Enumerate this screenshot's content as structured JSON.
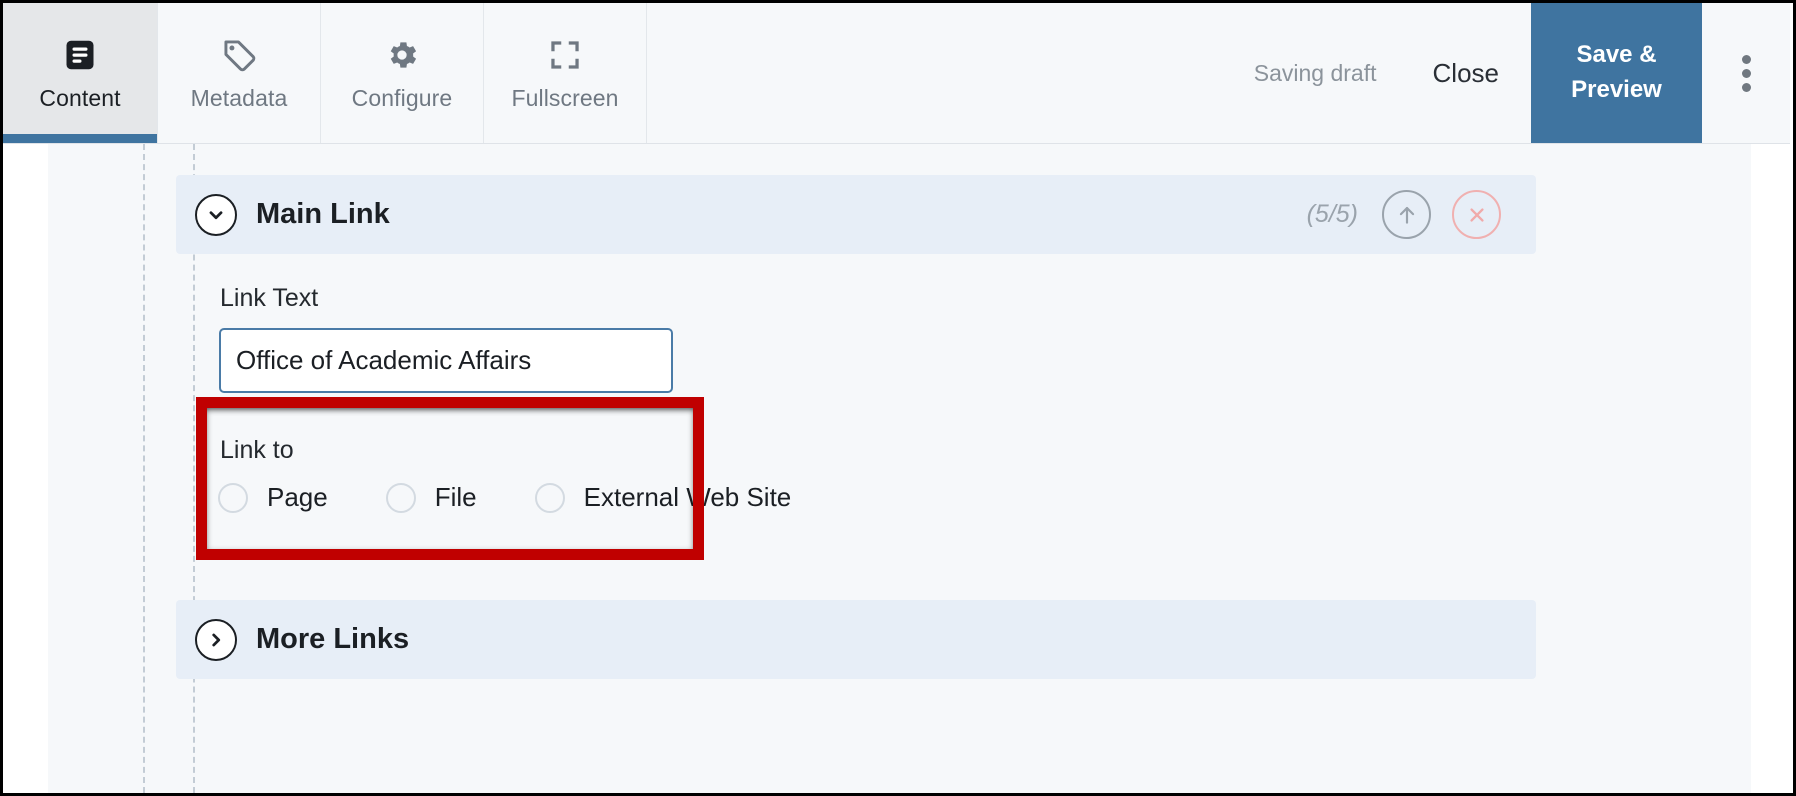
{
  "toolbar": {
    "tabs": [
      {
        "label": "Content",
        "icon": "document-lines-icon",
        "active": true
      },
      {
        "label": "Metadata",
        "icon": "tag-icon",
        "active": false
      },
      {
        "label": "Configure",
        "icon": "gear-icon",
        "active": false
      },
      {
        "label": "Fullscreen",
        "icon": "expand-icon",
        "active": false
      }
    ],
    "status_text": "Saving draft",
    "close_label": "Close",
    "save_label": "Save & Preview",
    "kebab_icon": "more-vertical-icon",
    "accent_color": "#3f74a0"
  },
  "panels": {
    "main_link": {
      "title": "Main Link",
      "toggle_icon": "chevron-down-icon",
      "counter": "(5/5)",
      "move_up_icon": "arrow-up-icon",
      "remove_icon": "close-circle-icon",
      "expanded": true,
      "header_color": "#e7eef7"
    },
    "more_links": {
      "title": "More Links",
      "toggle_icon": "chevron-right-icon",
      "expanded": false,
      "header_color": "#e7eef7"
    }
  },
  "form": {
    "link_text": {
      "label": "Link Text",
      "value": "Office of Academic Affairs",
      "placeholder": ""
    },
    "link_to": {
      "label": "Link to",
      "options": [
        {
          "label": "Page",
          "selected": false
        },
        {
          "label": "File",
          "selected": false
        },
        {
          "label": "External Web Site",
          "selected": false
        }
      ]
    }
  },
  "annotation": {
    "highlight_color": "#c00000",
    "target": "link-text-field"
  }
}
